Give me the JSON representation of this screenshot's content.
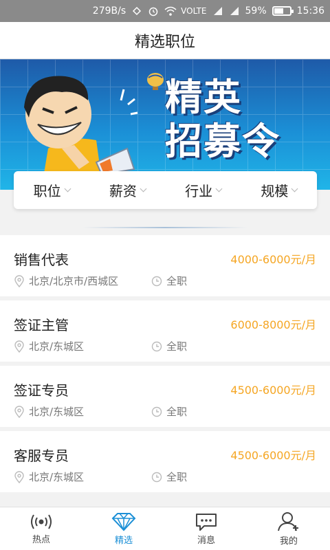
{
  "status_bar": {
    "speed": "279B/s",
    "network": "VOLTE",
    "battery": "59%",
    "battery_level": 0.59,
    "time": "15:36"
  },
  "header": {
    "title": "精选职位"
  },
  "banner": {
    "line1": "精英",
    "line2": "招募令"
  },
  "filters": [
    {
      "label": "职位"
    },
    {
      "label": "薪资"
    },
    {
      "label": "行业"
    },
    {
      "label": "规模"
    }
  ],
  "jobs": [
    {
      "title": "销售代表",
      "salary": "4000-6000元/月",
      "location": "北京/北京市/西城区",
      "type": "全职"
    },
    {
      "title": "签证主管",
      "salary": "6000-8000元/月",
      "location": "北京/东城区",
      "type": "全职"
    },
    {
      "title": "签证专员",
      "salary": "4500-6000元/月",
      "location": "北京/东城区",
      "type": "全职"
    },
    {
      "title": "客服专员",
      "salary": "4500-6000元/月",
      "location": "北京/东城区",
      "type": "全职"
    }
  ],
  "tabs": [
    {
      "label": "热点",
      "icon": "broadcast-icon"
    },
    {
      "label": "精选",
      "icon": "diamond-icon"
    },
    {
      "label": "消息",
      "icon": "chat-icon"
    },
    {
      "label": "我的",
      "icon": "user-icon"
    }
  ],
  "colors": {
    "accent": "#1b8fd6",
    "salary": "#f5a623"
  }
}
